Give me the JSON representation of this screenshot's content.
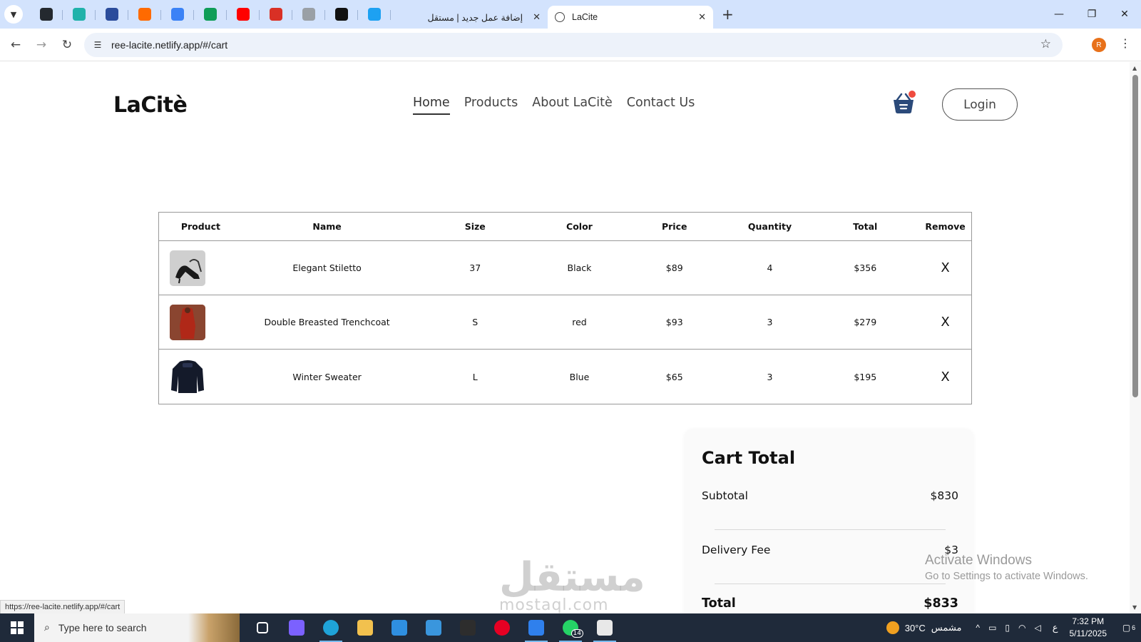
{
  "browser": {
    "pinned_tabs": [
      {
        "name": "github-icon",
        "color": "#24292f"
      },
      {
        "name": "diamond-icon",
        "color": "#20b2aa"
      },
      {
        "name": "bank-icon",
        "color": "#2b4c9b"
      },
      {
        "name": "flame-icon",
        "color": "#ff6a00"
      },
      {
        "name": "sparkle-icon",
        "color": "#3b82f6"
      },
      {
        "name": "sheets-icon",
        "color": "#0f9d58"
      },
      {
        "name": "youtube-icon",
        "color": "#ff0000"
      },
      {
        "name": "gmail-icon",
        "color": "#d93025"
      },
      {
        "name": "image-icon",
        "color": "#9aa0a6"
      },
      {
        "name": "openai-icon",
        "color": "#111111"
      },
      {
        "name": "circle-app-icon",
        "color": "#1da1f2"
      }
    ],
    "tabs": [
      {
        "title": "إضافة عمل جديد | مستقل",
        "close": "✕"
      },
      {
        "title": "LaCite",
        "close": "✕"
      }
    ],
    "new_tab": "+",
    "window_controls": [
      "—",
      "❐",
      "✕"
    ],
    "url": "ree-lacite.netlify.app/#/cart",
    "profile_initial": "R",
    "status_url": "https://ree-lacite.netlify.app/#/cart"
  },
  "site": {
    "logo": "LaCitè",
    "nav": [
      "Home",
      "Products",
      "About LaCitè",
      "Contact Us"
    ],
    "login_label": "Login",
    "accent": "#2b4a7a",
    "cart_dot_color": "#ef4b3f"
  },
  "cart": {
    "headers": [
      "Product",
      "Name",
      "Size",
      "Color",
      "Price",
      "Quantity",
      "Total",
      "Remove"
    ],
    "items": [
      {
        "name": "Elegant Stiletto",
        "size": "37",
        "color": "Black",
        "price": "$89",
        "quantity": "4",
        "total": "$356",
        "remove": "X"
      },
      {
        "name": "Double Breasted Trenchcoat",
        "size": "S",
        "color": "red",
        "price": "$93",
        "quantity": "3",
        "total": "$279",
        "remove": "X"
      },
      {
        "name": "Winter Sweater",
        "size": "L",
        "color": "Blue",
        "price": "$65",
        "quantity": "3",
        "total": "$195",
        "remove": "X"
      }
    ]
  },
  "totals": {
    "title": "Cart Total",
    "subtotal_label": "Subtotal",
    "subtotal": "$830",
    "delivery_label": "Delivery Fee",
    "delivery": "$3",
    "total_label": "Total",
    "total": "$833"
  },
  "overlay": {
    "activate_title": "Activate Windows",
    "activate_sub": "Go to Settings to activate Windows.",
    "watermark_ar": "مستقل",
    "watermark_en": "mostaql.com"
  },
  "taskbar": {
    "search_placeholder": "Type here to search",
    "apps": [
      {
        "name": "task-view-icon",
        "color": "#ffffff"
      },
      {
        "name": "copilot-icon",
        "color": "#7b61ff"
      },
      {
        "name": "edge-icon",
        "color": "#1fa3d8"
      },
      {
        "name": "file-explorer-icon",
        "color": "#f2c14e"
      },
      {
        "name": "store-icon",
        "color": "#2f8fe0"
      },
      {
        "name": "mail-icon",
        "color": "#3a96dd"
      },
      {
        "name": "terminal-icon",
        "color": "#2d2d2d"
      },
      {
        "name": "pinterest-icon",
        "color": "#e60023"
      },
      {
        "name": "vscode-icon",
        "color": "#2f80ed"
      },
      {
        "name": "whatsapp-icon",
        "color": "#25d366"
      },
      {
        "name": "notepad-icon",
        "color": "#e8e8e8"
      }
    ],
    "whatsapp_badge": "14",
    "weather_temp": "30°C",
    "weather_text": "مشمس",
    "lang": "ع",
    "time": "7:32 PM",
    "date": "5/11/2025",
    "notif_count": "6"
  }
}
